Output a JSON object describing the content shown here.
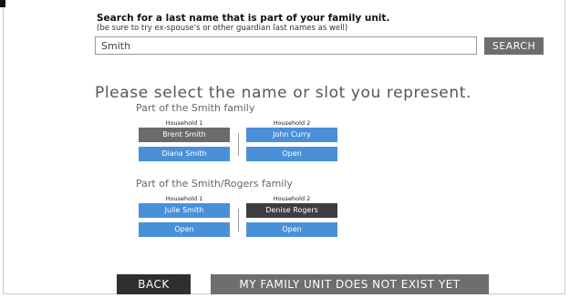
{
  "search": {
    "title": "Search for a last name that is part of your family unit.",
    "hint": "(be sure to try ex-spouse's or other guardian last names as well)",
    "value": "Smith",
    "button_label": "SEARCH"
  },
  "prompt": "Please select the name or slot you represent.",
  "families": [
    {
      "label": "Part of the Smith family",
      "households": [
        {
          "label": "Household 1",
          "slots": [
            "Brent Smith",
            "Diana Smith"
          ]
        },
        {
          "label": "Household 2",
          "slots": [
            "John Curry",
            "Open"
          ]
        }
      ]
    },
    {
      "label": "Part of the Smith/Rogers family",
      "households": [
        {
          "label": "Household 1",
          "slots": [
            "Julie Smith",
            "Open"
          ]
        },
        {
          "label": "Household 2",
          "slots": [
            "Denise Rogers",
            "Open"
          ]
        }
      ]
    }
  ],
  "footer": {
    "back_label": "BACK",
    "no_family_label": "MY FAMILY UNIT DOES NOT EXIST YET"
  },
  "colors": {
    "slot_blue": "#4a90d9",
    "slot_selected_gray": "#6b6b6b",
    "slot_dark": "#3e3e3e",
    "button_gray": "#6e6e6e",
    "button_dark": "#2f2f2f"
  }
}
